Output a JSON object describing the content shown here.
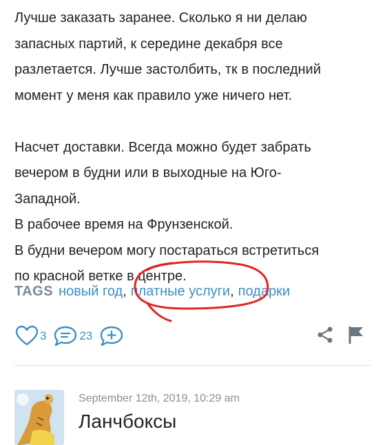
{
  "post": {
    "paragraph1": [
      "Лучше заказать заранее. Сколько я ни делаю",
      "запасных партий, к середине декабря все",
      "разлетается. Лучше застолбить, тк в последний",
      "момент у меня как правило уже ничего нет."
    ],
    "paragraph2": [
      "Насчет доставки. Всегда можно будет забрать",
      "вечером в будни или в выходные на Юго-",
      "Западной.",
      "В рабочее время на Фрунзенской.",
      "В будни вечером могу постараться встретиться",
      "по красной ветке в центре."
    ]
  },
  "tags": {
    "label": "TAGS",
    "items": [
      "новый год",
      "платные услуги",
      "подарки"
    ],
    "separator": ","
  },
  "annotation": {
    "color": "#e02424",
    "circled_tag": "платные услуги"
  },
  "actions": {
    "like_count": "3",
    "comment_count": "23",
    "accent_color": "#3b8fc4",
    "icons": [
      "heart-icon",
      "comment-icon",
      "add-comment-icon",
      "share-icon",
      "flag-icon"
    ]
  },
  "next_post": {
    "date": "September 12th, 2019, 10:29 am",
    "title": "Ланчбоксы"
  }
}
